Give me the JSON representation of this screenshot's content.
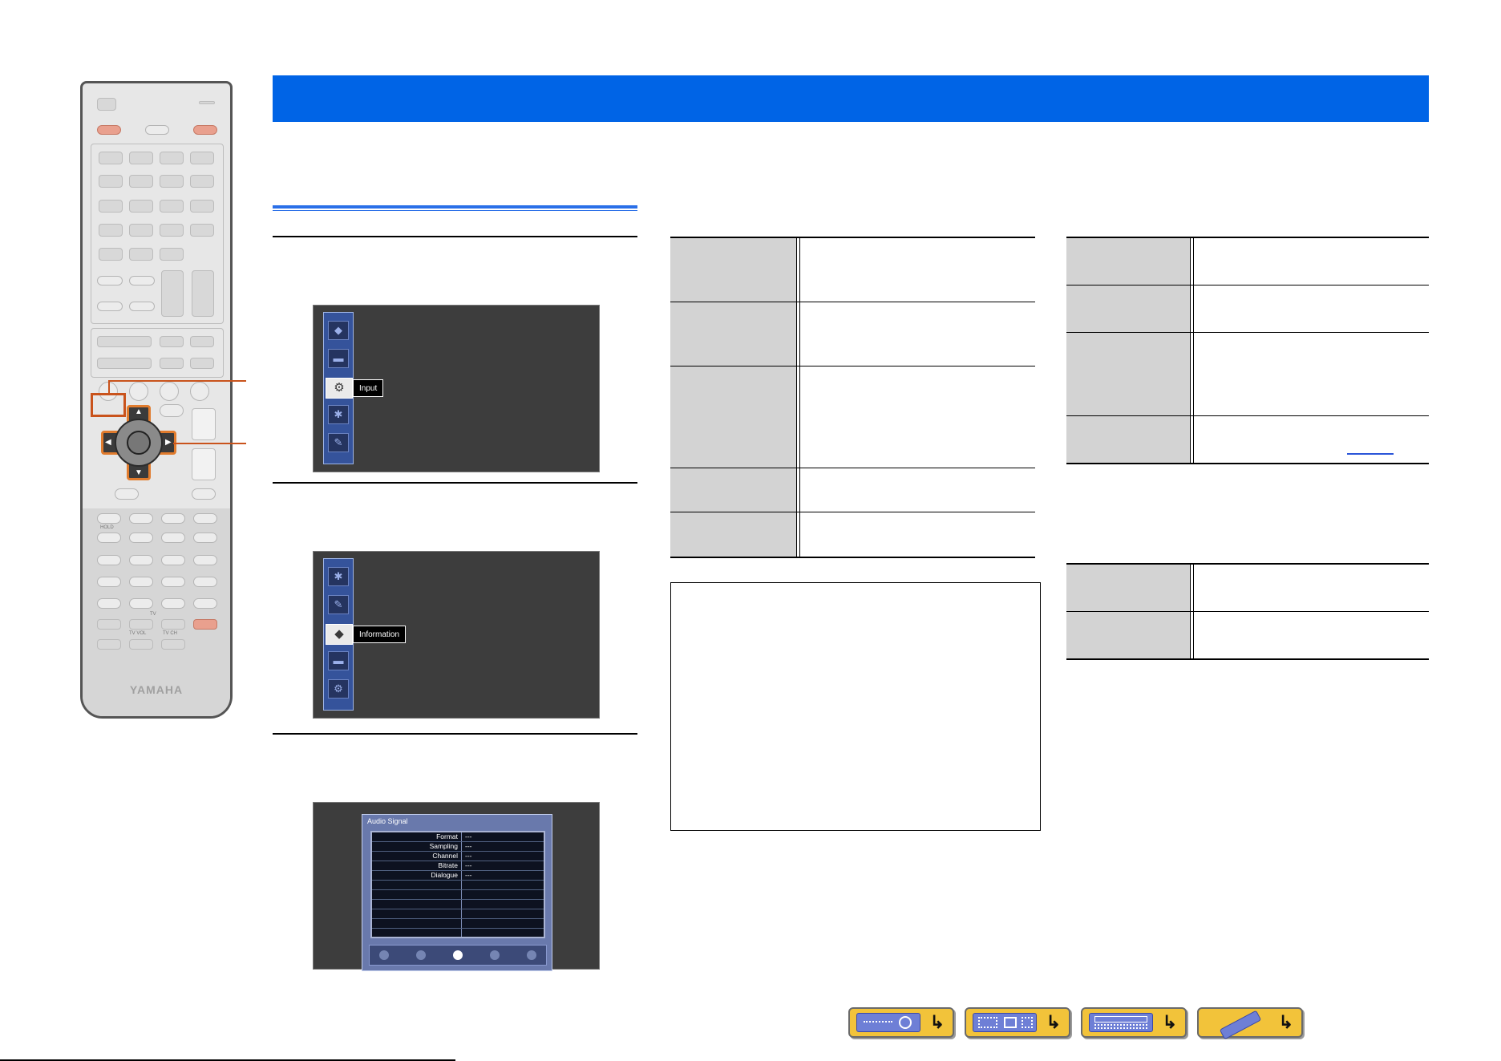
{
  "remote": {
    "brand": "YAMAHA",
    "label_hold": "HOLD",
    "label_tv": "TV",
    "label_tv_vol": "TV VOL",
    "label_tv_ch": "TV CH"
  },
  "screen1": {
    "menu_icons": [
      "tag-icon",
      "folder-icon",
      "input-icon",
      "speaker-icon",
      "tool-icon"
    ],
    "selected_label": "Input"
  },
  "screen2": {
    "menu_icons": [
      "speaker-icon",
      "tool-icon",
      "info-icon",
      "folder-icon",
      "input-icon"
    ],
    "selected_label": "Information"
  },
  "screen3": {
    "title": "Audio Signal",
    "rows": [
      {
        "key": "Format",
        "value": "---"
      },
      {
        "key": "Sampling",
        "value": "---"
      },
      {
        "key": "Channel",
        "value": "---"
      },
      {
        "key": "Bitrate",
        "value": "---"
      },
      {
        "key": "Dialogue",
        "value": "---"
      }
    ]
  },
  "colors": {
    "header_blue": "#0064e6",
    "callout_orange": "#c9531c",
    "table_key_gray": "#d3d3d3",
    "nav_button_yellow": "#f2c33a"
  },
  "nav_buttons": [
    {
      "icon": "front-panel-icon"
    },
    {
      "icon": "rear-panel-icon"
    },
    {
      "icon": "display-icon"
    },
    {
      "icon": "remote-icon"
    }
  ]
}
